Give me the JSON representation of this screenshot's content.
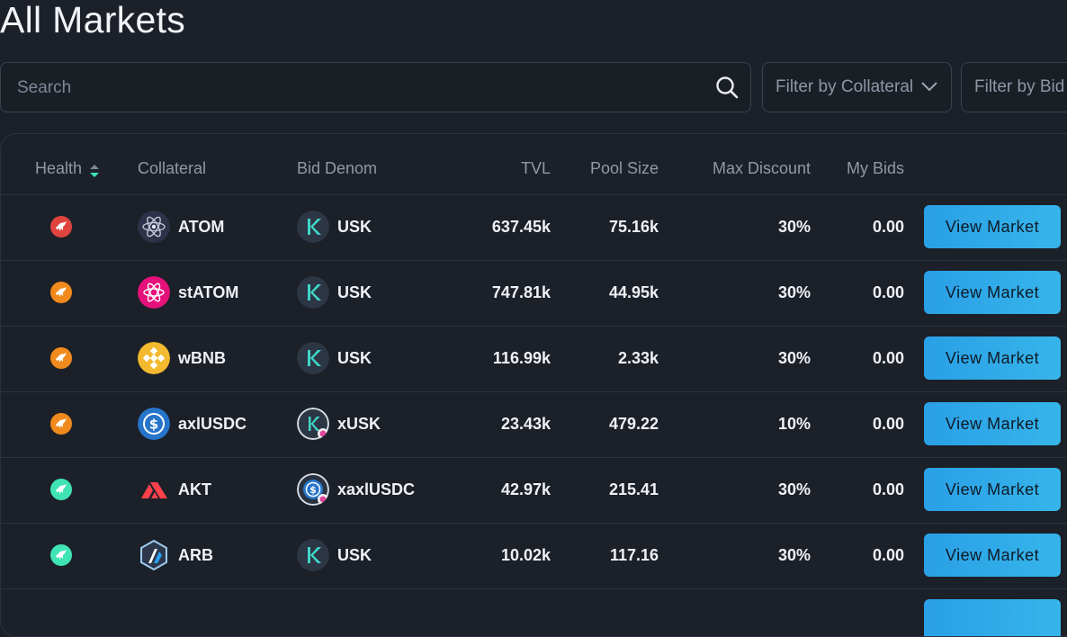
{
  "page": {
    "title": "All Markets"
  },
  "search": {
    "placeholder": "Search"
  },
  "filters": {
    "collateral_label": "Filter by Collateral",
    "bid_label": "Filter by Bid"
  },
  "table": {
    "headers": {
      "health": "Health",
      "collateral": "Collateral",
      "bid_denom": "Bid Denom",
      "tvl": "TVL",
      "pool_size": "Pool Size",
      "max_discount": "Max Discount",
      "my_bids": "My Bids"
    },
    "rows": [
      {
        "health_color": "#e0443e",
        "collateral": "ATOM",
        "collateral_icon": "atom-icon",
        "bid_denom": "USK",
        "bid_icon": "usk-icon",
        "tvl": "637.45k",
        "pool_size": "75.16k",
        "max_discount": "30%",
        "my_bids": "0.00",
        "action": "View Market"
      },
      {
        "health_color": "#f08a1c",
        "collateral": "stATOM",
        "collateral_icon": "statom-icon",
        "bid_denom": "USK",
        "bid_icon": "usk-icon",
        "tvl": "747.81k",
        "pool_size": "44.95k",
        "max_discount": "30%",
        "my_bids": "0.00",
        "action": "View Market"
      },
      {
        "health_color": "#f08a1c",
        "collateral": "wBNB",
        "collateral_icon": "bnb-icon",
        "bid_denom": "USK",
        "bid_icon": "usk-icon",
        "tvl": "116.99k",
        "pool_size": "2.33k",
        "max_discount": "30%",
        "my_bids": "0.00",
        "action": "View Market"
      },
      {
        "health_color": "#f08a1c",
        "collateral": "axlUSDC",
        "collateral_icon": "usdc-icon",
        "bid_denom": "xUSK",
        "bid_icon": "xusk-icon",
        "tvl": "23.43k",
        "pool_size": "479.22",
        "max_discount": "10%",
        "my_bids": "0.00",
        "action": "View Market"
      },
      {
        "health_color": "#3fe3b4",
        "collateral": "AKT",
        "collateral_icon": "akash-icon",
        "bid_denom": "xaxlUSDC",
        "bid_icon": "xaxlusdc-icon",
        "tvl": "42.97k",
        "pool_size": "215.41",
        "max_discount": "30%",
        "my_bids": "0.00",
        "action": "View Market"
      },
      {
        "health_color": "#3fe3b4",
        "collateral": "ARB",
        "collateral_icon": "arbitrum-icon",
        "bid_denom": "USK",
        "bid_icon": "usk-icon",
        "tvl": "10.02k",
        "pool_size": "117.16",
        "max_discount": "30%",
        "my_bids": "0.00",
        "action": "View Market"
      }
    ]
  },
  "colors": {
    "accent": "#2a9fe6",
    "background": "#1c2028",
    "sort_indicator": "#3fe3b4"
  }
}
